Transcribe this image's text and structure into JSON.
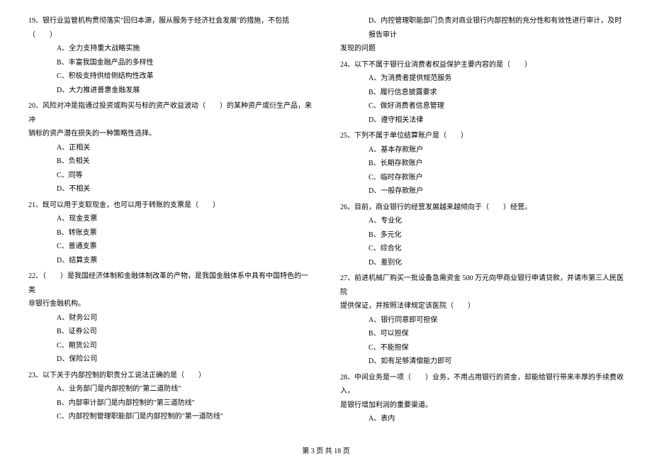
{
  "questions": [
    {
      "num": "19",
      "text": "银行业监管机构贯彻落实\"回归本源，服从服务于经济社会发展\"的措施，不包括（　　）",
      "options": [
        "A、全力支持重大战略实施",
        "B、丰富我国金融产品的多样性",
        "C、积极支持供给侧结构性改革",
        "D、大力推进普惠金融发展"
      ]
    },
    {
      "num": "20",
      "text": "风险对冲是指通过投资或购买与标的资产收益波动（　　）的某种资产或衍生产品，来冲",
      "continuation": "销标的资产潜在损失的一种策略性选择。",
      "options": [
        "A、正相关",
        "B、负相关",
        "C、同等",
        "D、不相关"
      ]
    },
    {
      "num": "21",
      "text": "既可以用于支取现金，也可以用于转账的支票是（　　）",
      "options": [
        "A、现金支票",
        "B、转账支票",
        "C、普通支票",
        "D、结算支票"
      ]
    },
    {
      "num": "22",
      "text": "（　　）是我国经济体制和金融体制改革的产物，是我国金融体系中具有中国特色的一类",
      "continuation": "非银行金融机构。",
      "options": [
        "A、财务公司",
        "B、证券公司",
        "C、期货公司",
        "D、保险公司"
      ]
    },
    {
      "num": "23",
      "text": "以下关于内部控制的职责分工说法正确的是（　　）",
      "options": [
        "A、业务部门是内部控制的\"第二道防线\"",
        "B、内部审计部门是内部控制的\"第三道防线\"",
        "C、内部控制管理职能部门是内部控制的\"第一道防线\""
      ]
    },
    {
      "num": "23d",
      "option_only": "D、内控管理职能部门负责对商业银行内部控制的充分性和有效性进行审计，及时报告审计",
      "continuation": "发现的问题"
    },
    {
      "num": "24",
      "text": "以下不属于银行业消费者权益保护主要内容的是（　　）",
      "options": [
        "A、为消费者提供规范服务",
        "B、履行信息披露要求",
        "C、做好消费者信息管理",
        "D、遵守相关法律"
      ]
    },
    {
      "num": "25",
      "text": "下列不属于单位结算账户是（　　）",
      "options": [
        "A、基本存款账户",
        "B、长期存款账户",
        "C、临时存款账户",
        "D、一般存款账户"
      ]
    },
    {
      "num": "26",
      "text": "目前，商业银行的经营发展越来越倾向于（　　）经营。",
      "options": [
        "A、专业化",
        "B、多元化",
        "C、综合化",
        "D、差别化"
      ]
    },
    {
      "num": "27",
      "text": "前进机械厂购买一批设备急需资金 500 万元向甲商业银行申请贷款，并请市第三人民医院",
      "continuation": "提供保证，并按照法律规定该医院（　　）",
      "options": [
        "A、银行同意即可担保",
        "B、可以担保",
        "C、不能担保",
        "D、如有足够清偿能力即可"
      ]
    },
    {
      "num": "28",
      "text": "中间业务是一项（　　）业务，不用占用银行的资金，却能给银行带来丰厚的手续费收入，",
      "continuation": "是银行增加利润的重要渠道。",
      "options": [
        "A、表内"
      ]
    }
  ],
  "footer": "第 3 页 共 18 页"
}
